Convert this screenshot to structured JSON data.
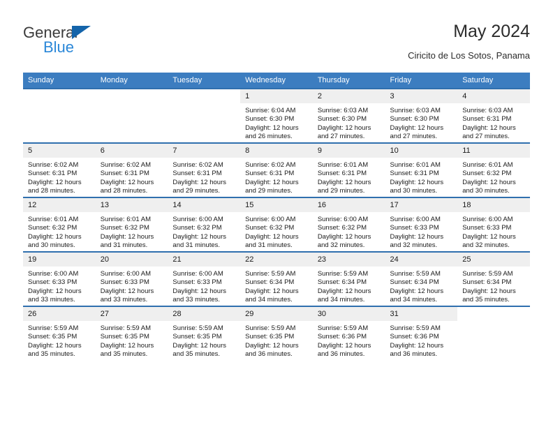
{
  "brand": {
    "name_top": "General",
    "name_bottom": "Blue",
    "triangle_color": "#1464aa",
    "blue_color": "#2a87d8"
  },
  "header": {
    "title": "May 2024",
    "subtitle": "Ciricito de Los Sotos, Panama"
  },
  "theme": {
    "header_row_bg": "#3c7dc0",
    "row_divider": "#2f6fae",
    "daynum_bg": "#efefef"
  },
  "calendar": {
    "weekday_headers": [
      "Sunday",
      "Monday",
      "Tuesday",
      "Wednesday",
      "Thursday",
      "Friday",
      "Saturday"
    ],
    "weeks": [
      [
        {
          "day": "",
          "lines": []
        },
        {
          "day": "",
          "lines": []
        },
        {
          "day": "",
          "lines": []
        },
        {
          "day": "1",
          "lines": [
            "Sunrise: 6:04 AM",
            "Sunset: 6:30 PM",
            "Daylight: 12 hours",
            "and 26 minutes."
          ]
        },
        {
          "day": "2",
          "lines": [
            "Sunrise: 6:03 AM",
            "Sunset: 6:30 PM",
            "Daylight: 12 hours",
            "and 27 minutes."
          ]
        },
        {
          "day": "3",
          "lines": [
            "Sunrise: 6:03 AM",
            "Sunset: 6:30 PM",
            "Daylight: 12 hours",
            "and 27 minutes."
          ]
        },
        {
          "day": "4",
          "lines": [
            "Sunrise: 6:03 AM",
            "Sunset: 6:31 PM",
            "Daylight: 12 hours",
            "and 27 minutes."
          ]
        }
      ],
      [
        {
          "day": "5",
          "lines": [
            "Sunrise: 6:02 AM",
            "Sunset: 6:31 PM",
            "Daylight: 12 hours",
            "and 28 minutes."
          ]
        },
        {
          "day": "6",
          "lines": [
            "Sunrise: 6:02 AM",
            "Sunset: 6:31 PM",
            "Daylight: 12 hours",
            "and 28 minutes."
          ]
        },
        {
          "day": "7",
          "lines": [
            "Sunrise: 6:02 AM",
            "Sunset: 6:31 PM",
            "Daylight: 12 hours",
            "and 29 minutes."
          ]
        },
        {
          "day": "8",
          "lines": [
            "Sunrise: 6:02 AM",
            "Sunset: 6:31 PM",
            "Daylight: 12 hours",
            "and 29 minutes."
          ]
        },
        {
          "day": "9",
          "lines": [
            "Sunrise: 6:01 AM",
            "Sunset: 6:31 PM",
            "Daylight: 12 hours",
            "and 29 minutes."
          ]
        },
        {
          "day": "10",
          "lines": [
            "Sunrise: 6:01 AM",
            "Sunset: 6:31 PM",
            "Daylight: 12 hours",
            "and 30 minutes."
          ]
        },
        {
          "day": "11",
          "lines": [
            "Sunrise: 6:01 AM",
            "Sunset: 6:32 PM",
            "Daylight: 12 hours",
            "and 30 minutes."
          ]
        }
      ],
      [
        {
          "day": "12",
          "lines": [
            "Sunrise: 6:01 AM",
            "Sunset: 6:32 PM",
            "Daylight: 12 hours",
            "and 30 minutes."
          ]
        },
        {
          "day": "13",
          "lines": [
            "Sunrise: 6:01 AM",
            "Sunset: 6:32 PM",
            "Daylight: 12 hours",
            "and 31 minutes."
          ]
        },
        {
          "day": "14",
          "lines": [
            "Sunrise: 6:00 AM",
            "Sunset: 6:32 PM",
            "Daylight: 12 hours",
            "and 31 minutes."
          ]
        },
        {
          "day": "15",
          "lines": [
            "Sunrise: 6:00 AM",
            "Sunset: 6:32 PM",
            "Daylight: 12 hours",
            "and 31 minutes."
          ]
        },
        {
          "day": "16",
          "lines": [
            "Sunrise: 6:00 AM",
            "Sunset: 6:32 PM",
            "Daylight: 12 hours",
            "and 32 minutes."
          ]
        },
        {
          "day": "17",
          "lines": [
            "Sunrise: 6:00 AM",
            "Sunset: 6:33 PM",
            "Daylight: 12 hours",
            "and 32 minutes."
          ]
        },
        {
          "day": "18",
          "lines": [
            "Sunrise: 6:00 AM",
            "Sunset: 6:33 PM",
            "Daylight: 12 hours",
            "and 32 minutes."
          ]
        }
      ],
      [
        {
          "day": "19",
          "lines": [
            "Sunrise: 6:00 AM",
            "Sunset: 6:33 PM",
            "Daylight: 12 hours",
            "and 33 minutes."
          ]
        },
        {
          "day": "20",
          "lines": [
            "Sunrise: 6:00 AM",
            "Sunset: 6:33 PM",
            "Daylight: 12 hours",
            "and 33 minutes."
          ]
        },
        {
          "day": "21",
          "lines": [
            "Sunrise: 6:00 AM",
            "Sunset: 6:33 PM",
            "Daylight: 12 hours",
            "and 33 minutes."
          ]
        },
        {
          "day": "22",
          "lines": [
            "Sunrise: 5:59 AM",
            "Sunset: 6:34 PM",
            "Daylight: 12 hours",
            "and 34 minutes."
          ]
        },
        {
          "day": "23",
          "lines": [
            "Sunrise: 5:59 AM",
            "Sunset: 6:34 PM",
            "Daylight: 12 hours",
            "and 34 minutes."
          ]
        },
        {
          "day": "24",
          "lines": [
            "Sunrise: 5:59 AM",
            "Sunset: 6:34 PM",
            "Daylight: 12 hours",
            "and 34 minutes."
          ]
        },
        {
          "day": "25",
          "lines": [
            "Sunrise: 5:59 AM",
            "Sunset: 6:34 PM",
            "Daylight: 12 hours",
            "and 35 minutes."
          ]
        }
      ],
      [
        {
          "day": "26",
          "lines": [
            "Sunrise: 5:59 AM",
            "Sunset: 6:35 PM",
            "Daylight: 12 hours",
            "and 35 minutes."
          ]
        },
        {
          "day": "27",
          "lines": [
            "Sunrise: 5:59 AM",
            "Sunset: 6:35 PM",
            "Daylight: 12 hours",
            "and 35 minutes."
          ]
        },
        {
          "day": "28",
          "lines": [
            "Sunrise: 5:59 AM",
            "Sunset: 6:35 PM",
            "Daylight: 12 hours",
            "and 35 minutes."
          ]
        },
        {
          "day": "29",
          "lines": [
            "Sunrise: 5:59 AM",
            "Sunset: 6:35 PM",
            "Daylight: 12 hours",
            "and 36 minutes."
          ]
        },
        {
          "day": "30",
          "lines": [
            "Sunrise: 5:59 AM",
            "Sunset: 6:36 PM",
            "Daylight: 12 hours",
            "and 36 minutes."
          ]
        },
        {
          "day": "31",
          "lines": [
            "Sunrise: 5:59 AM",
            "Sunset: 6:36 PM",
            "Daylight: 12 hours",
            "and 36 minutes."
          ]
        },
        {
          "day": "",
          "lines": []
        }
      ]
    ]
  }
}
